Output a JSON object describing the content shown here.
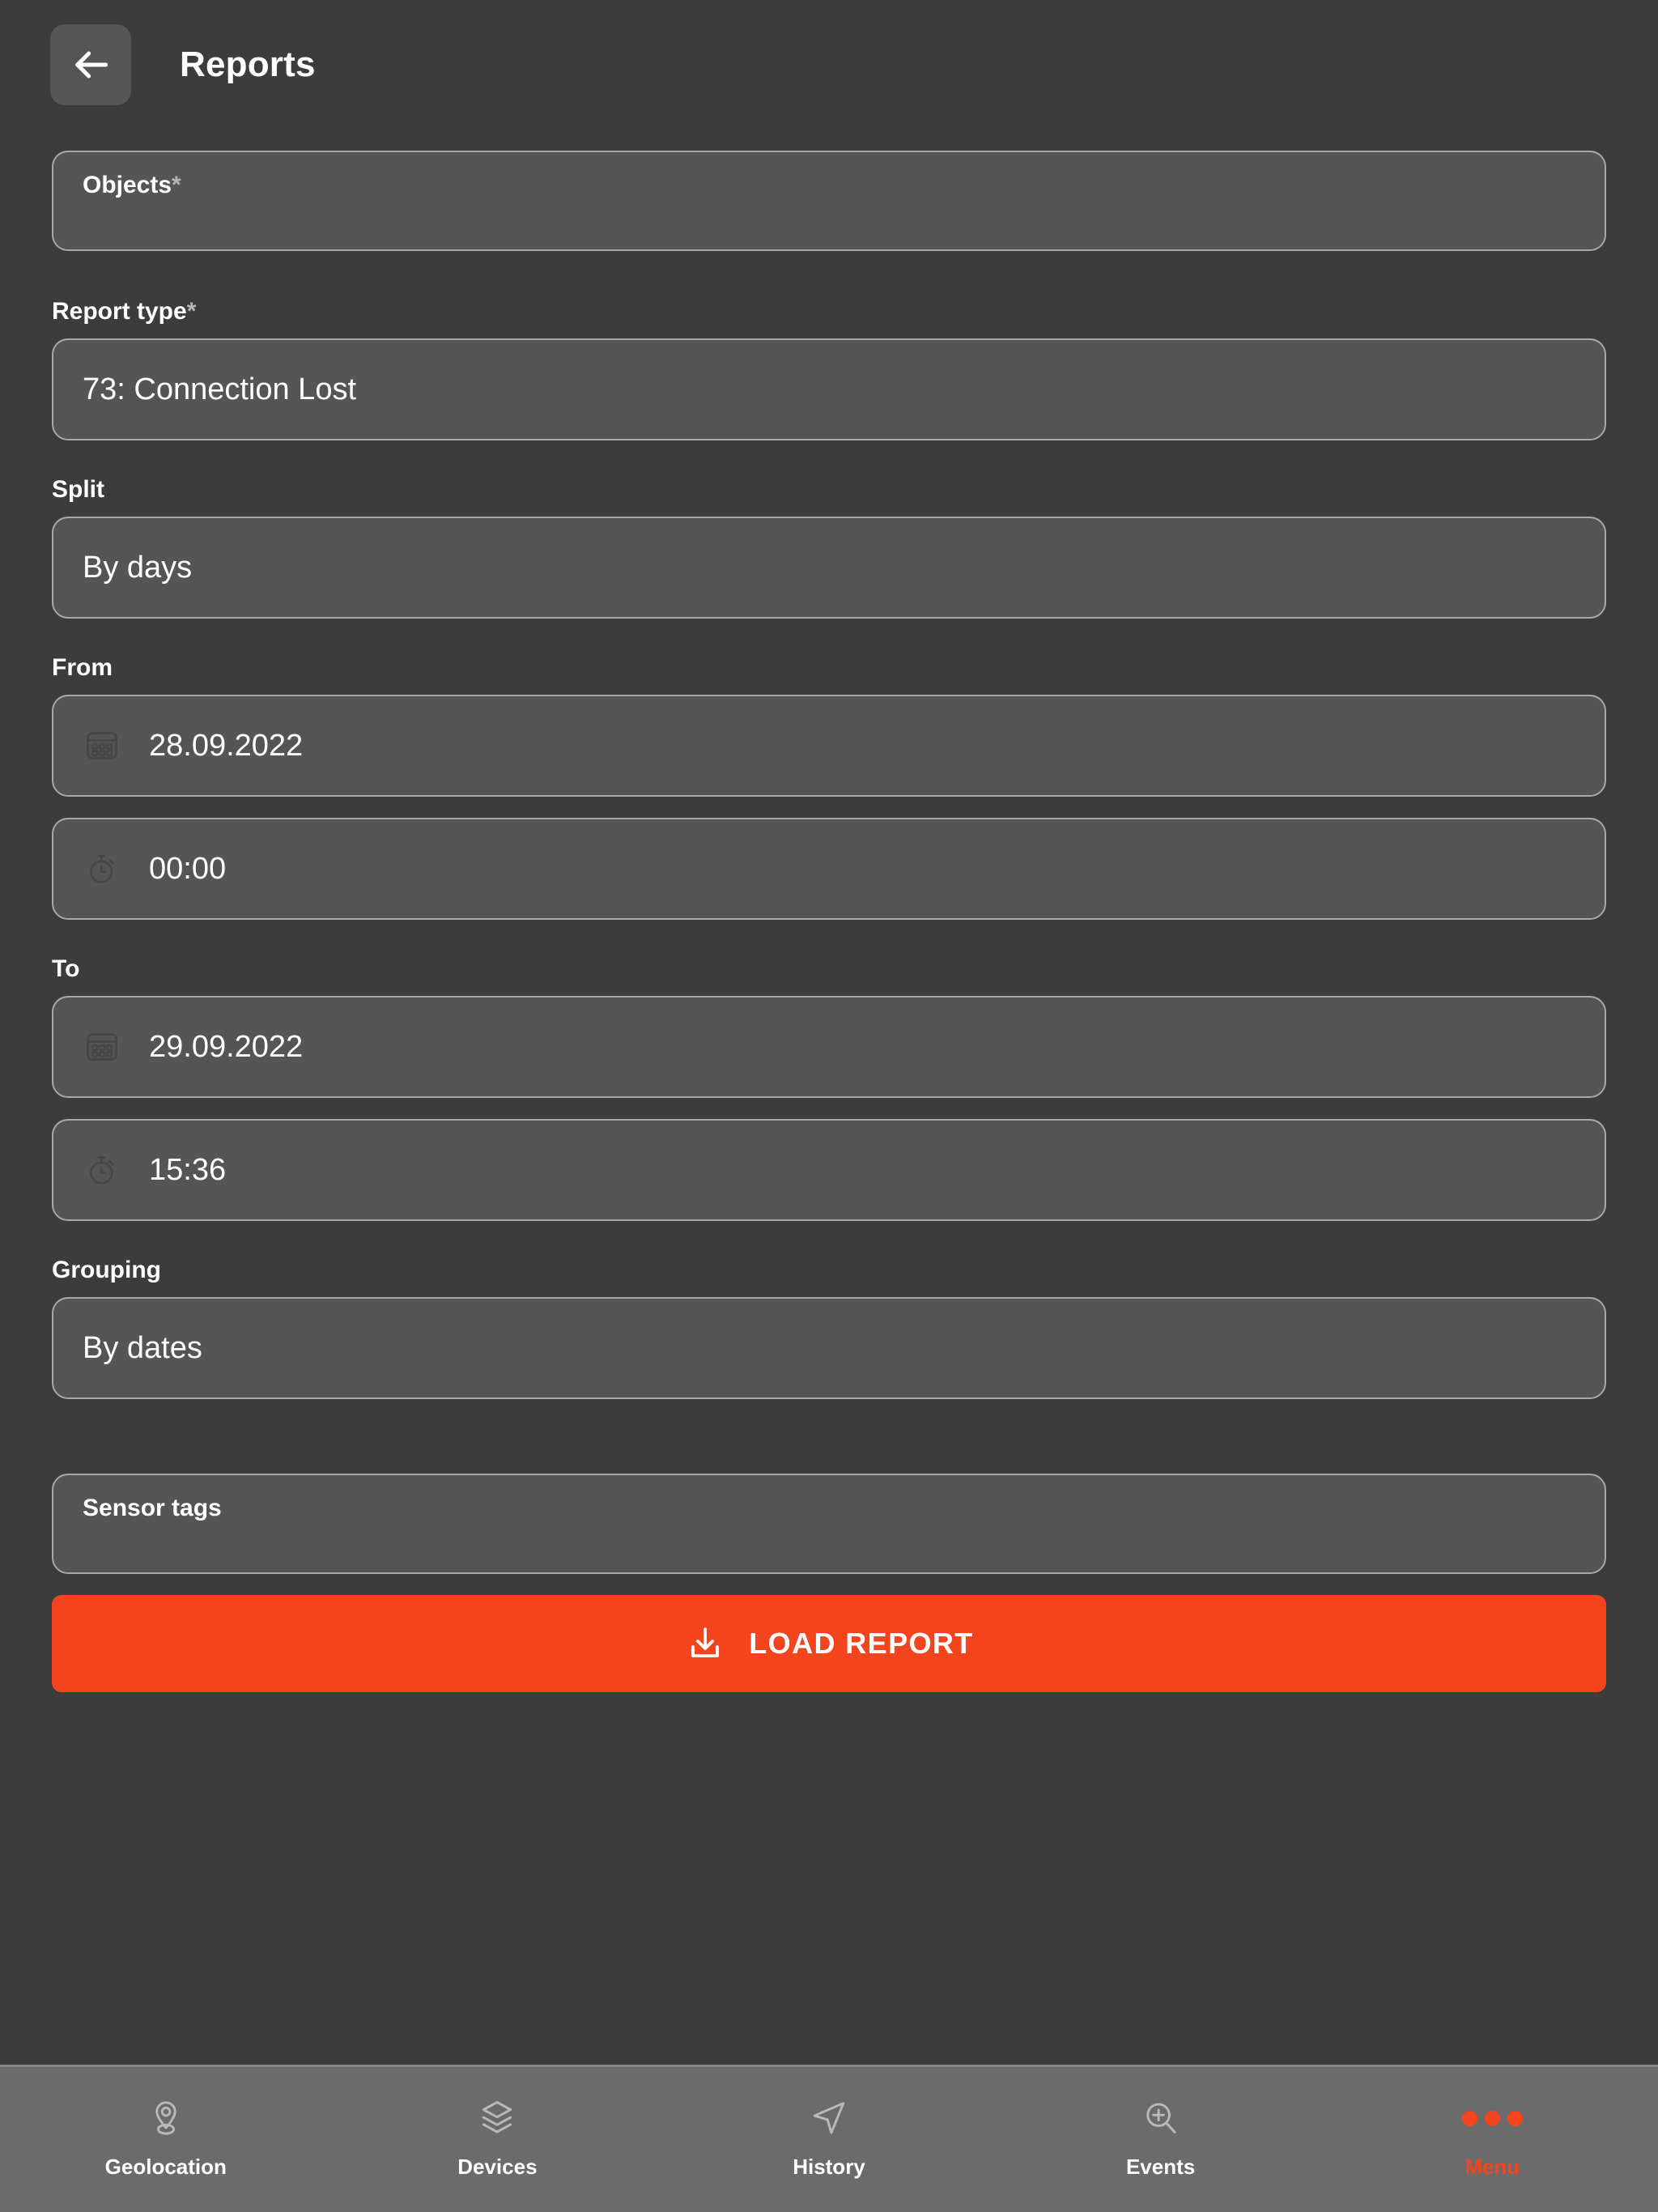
{
  "header": {
    "back_icon": "arrow-left-icon",
    "title": "Reports"
  },
  "form": {
    "objects": {
      "label": "Objects",
      "required_marker": "*",
      "value": ""
    },
    "report_type": {
      "label": "Report type",
      "required_marker": "*",
      "value": "73: Connection Lost"
    },
    "split": {
      "label": "Split",
      "value": "By days"
    },
    "from": {
      "label": "From",
      "date_icon": "calendar-icon",
      "date_value": "28.09.2022",
      "time_icon": "stopwatch-icon",
      "time_value": "00:00"
    },
    "to": {
      "label": "To",
      "date_icon": "calendar-icon",
      "date_value": "29.09.2022",
      "time_icon": "stopwatch-icon",
      "time_value": "15:36"
    },
    "grouping": {
      "label": "Grouping",
      "value": "By dates"
    },
    "sensor_tags": {
      "label": "Sensor tags",
      "value": ""
    },
    "submit": {
      "icon": "download-icon",
      "label": "LOAD REPORT"
    }
  },
  "bottom_nav": {
    "items": [
      {
        "label": "Geolocation",
        "icon": "map-pin-icon",
        "active": false
      },
      {
        "label": "Devices",
        "icon": "layers-icon",
        "active": false
      },
      {
        "label": "History",
        "icon": "navigation-arrow-icon",
        "active": false
      },
      {
        "label": "Events",
        "icon": "search-plus-icon",
        "active": false
      },
      {
        "label": "Menu",
        "icon": "three-dots-icon",
        "active": true
      }
    ]
  },
  "colors": {
    "page_background": "#3c3c3c",
    "field_background": "#555555",
    "field_border": "#a9a9a9",
    "accent": "#f4441e",
    "nav_background": "#6b6b6b",
    "text_primary": "#ffffff"
  }
}
